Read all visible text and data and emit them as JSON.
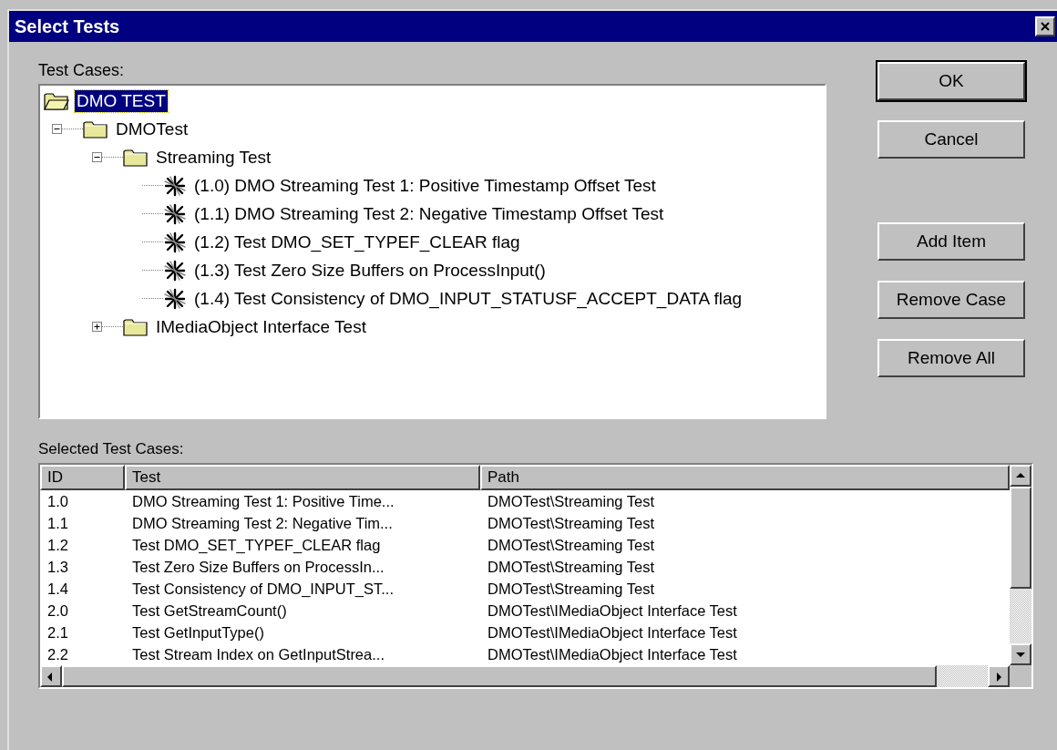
{
  "window": {
    "title": "Select Tests"
  },
  "tree": {
    "label": "Test Cases:",
    "items": [
      {
        "label": "DMO TEST",
        "kind": "folder",
        "expanded": true,
        "selected": true,
        "children": [
          {
            "label": "DMOTest",
            "kind": "folder",
            "expanded": true,
            "selected": false,
            "children": [
              {
                "label": "Streaming Test",
                "kind": "folder",
                "expanded": true,
                "selected": false,
                "children": [
                  {
                    "label": "(1.0) DMO Streaming Test 1: Positive Timestamp Offset Test",
                    "kind": "test",
                    "selected": false
                  },
                  {
                    "label": "(1.1) DMO Streaming Test 2: Negative Timestamp Offset Test",
                    "kind": "test",
                    "selected": false
                  },
                  {
                    "label": "(1.2) Test DMO_SET_TYPEF_CLEAR flag",
                    "kind": "test",
                    "selected": false
                  },
                  {
                    "label": "(1.3) Test Zero Size Buffers on ProcessInput()",
                    "kind": "test",
                    "selected": false
                  },
                  {
                    "label": "(1.4) Test Consistency of DMO_INPUT_STATUSF_ACCEPT_DATA flag",
                    "kind": "test",
                    "selected": false
                  }
                ]
              },
              {
                "label": "IMediaObject Interface Test",
                "kind": "folder",
                "expanded": false,
                "selected": false
              }
            ]
          }
        ]
      }
    ]
  },
  "buttons": [
    {
      "label": "OK",
      "default": true
    },
    {
      "label": "Cancel",
      "default": false
    },
    {
      "label": "Add Item",
      "default": false
    },
    {
      "label": "Remove Case",
      "default": false
    },
    {
      "label": "Remove All",
      "default": false
    }
  ],
  "selected_list": {
    "label": "Selected Test Cases:",
    "columns": [
      "ID",
      "Test",
      "Path"
    ],
    "rows": [
      [
        "1.0",
        "DMO Streaming Test 1: Positive Time...",
        "DMOTest\\Streaming Test"
      ],
      [
        "1.1",
        "DMO Streaming Test 2: Negative Tim...",
        "DMOTest\\Streaming Test"
      ],
      [
        "1.2",
        "Test DMO_SET_TYPEF_CLEAR flag",
        "DMOTest\\Streaming Test"
      ],
      [
        "1.3",
        "Test Zero Size Buffers on ProcessIn...",
        "DMOTest\\Streaming Test"
      ],
      [
        "1.4",
        "Test Consistency of DMO_INPUT_ST...",
        "DMOTest\\Streaming Test"
      ],
      [
        "2.0",
        "Test GetStreamCount()",
        "DMOTest\\IMediaObject Interface Test"
      ],
      [
        "2.1",
        "Test GetInputType()",
        "DMOTest\\IMediaObject Interface Test"
      ],
      [
        "2.2",
        "Test Stream Index on GetInputStrea...",
        "DMOTest\\IMediaObject Interface Test"
      ]
    ]
  }
}
